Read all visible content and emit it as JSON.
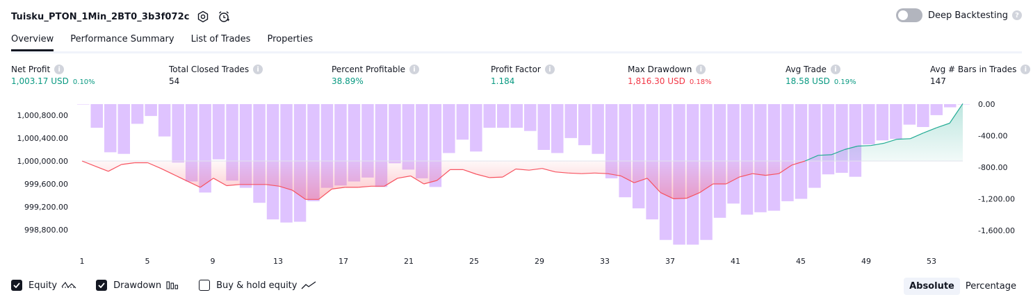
{
  "header": {
    "strategy_name": "Tuisku_PTON_1Min_2BT0_3b3f072c",
    "deep_backtesting_label": "Deep Backtesting"
  },
  "tabs": [
    {
      "label": "Overview",
      "active": true
    },
    {
      "label": "Performance Summary",
      "active": false
    },
    {
      "label": "List of Trades",
      "active": false
    },
    {
      "label": "Properties",
      "active": false
    }
  ],
  "metrics": [
    {
      "label": "Net Profit",
      "value": "1,003.17 USD",
      "pct": "0.10%",
      "tone": "pos"
    },
    {
      "label": "Total Closed Trades",
      "value": "54",
      "pct": "",
      "tone": "neu"
    },
    {
      "label": "Percent Profitable",
      "value": "38.89%",
      "pct": "",
      "tone": "pos"
    },
    {
      "label": "Profit Factor",
      "value": "1.184",
      "pct": "",
      "tone": "pos"
    },
    {
      "label": "Max Drawdown",
      "value": "1,816.30 USD",
      "pct": "0.18%",
      "tone": "neg"
    },
    {
      "label": "Avg Trade",
      "value": "18.58 USD",
      "pct": "0.19%",
      "tone": "pos"
    },
    {
      "label": "Avg # Bars in Trades",
      "value": "147",
      "pct": "",
      "tone": "neu"
    }
  ],
  "chart_data": {
    "type": "line",
    "left_axis_ticks": [
      "1,000,800.00",
      "1,000,400.00",
      "1,000,000.00",
      "999,600.00",
      "999,200.00",
      "998,800.00"
    ],
    "right_axis_ticks": [
      "0.00",
      "-400.00",
      "-800.00",
      "-1,200.00",
      "-1,600.00"
    ],
    "x_ticks": [
      "1",
      "5",
      "9",
      "13",
      "17",
      "21",
      "25",
      "29",
      "33",
      "37",
      "41",
      "45",
      "49",
      "53"
    ],
    "equity_baseline": 1000000,
    "equity": [
      1000000,
      999910,
      999820,
      999940,
      999970,
      999970,
      999870,
      999760,
      999650,
      999540,
      999700,
      999570,
      999590,
      999590,
      999590,
      999560,
      999490,
      999330,
      999330,
      999510,
      999540,
      999540,
      999560,
      999560,
      999700,
      999740,
      999600,
      999660,
      999850,
      999850,
      999770,
      999710,
      999720,
      999860,
      999840,
      999870,
      999810,
      999790,
      999780,
      999790,
      999780,
      999740,
      999620,
      999700,
      999450,
      999340,
      999350,
      999450,
      999600,
      999600,
      999720,
      999780,
      999750,
      999780,
      999930,
      1000000,
      1000100,
      1000110,
      1000200,
      1000260,
      1000270,
      1000310,
      1000380,
      1000390,
      1000490,
      1000580,
      1000660,
      1001003
    ],
    "drawdown": [
      0,
      -300,
      -610,
      -630,
      -250,
      -150,
      -410,
      -740,
      -980,
      -1120,
      -700,
      -970,
      -1060,
      -1250,
      -1460,
      -1500,
      -1490,
      -1230,
      -1060,
      -1030,
      -980,
      -930,
      -1050,
      -750,
      -830,
      -940,
      -1050,
      -620,
      -450,
      -600,
      -300,
      -300,
      -300,
      -340,
      -580,
      -620,
      -430,
      -520,
      -630,
      -940,
      -1180,
      -1320,
      -1460,
      -1720,
      -1780,
      -1780,
      -1720,
      -1440,
      -1260,
      -1400,
      -1370,
      -1350,
      -1230,
      -1200,
      -1060,
      -890,
      -870,
      -920,
      -510,
      -460,
      -440,
      -260,
      -290,
      -140,
      -40,
      0
    ],
    "colors": {
      "equity_up": "#22ab94",
      "equity_down": "#f7525f",
      "drawdown_bar": "#d9b8ff",
      "axis_text": "#131722"
    }
  },
  "legend": [
    {
      "label": "Equity",
      "checked": true,
      "icon": "equity-wave-icon"
    },
    {
      "label": "Drawdown",
      "checked": true,
      "icon": "drawdown-bars-icon"
    },
    {
      "label": "Buy & hold equity",
      "checked": false,
      "icon": "buyhold-line-icon"
    }
  ],
  "modes": [
    {
      "label": "Absolute",
      "active": true
    },
    {
      "label": "Percentage",
      "active": false
    }
  ]
}
